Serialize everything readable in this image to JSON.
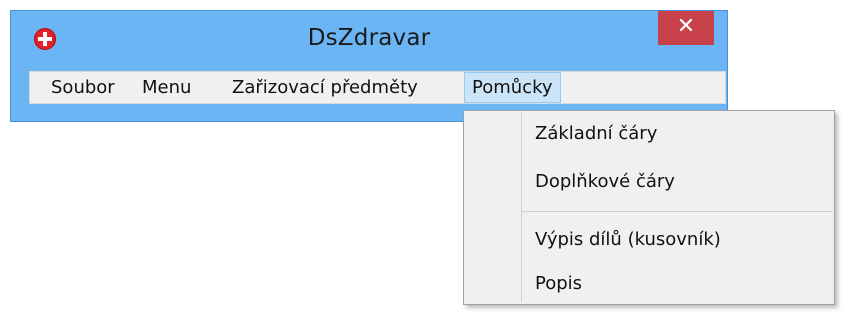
{
  "window": {
    "title": "DsZdravar",
    "close_label": "✕",
    "icon": "red-cross-app-icon"
  },
  "menubar": {
    "items": [
      {
        "label": "Soubor"
      },
      {
        "label": "Menu"
      },
      {
        "label": "Zařizovací předměty"
      },
      {
        "label": "Pomůcky",
        "active": true
      }
    ]
  },
  "dropdown": {
    "items": [
      {
        "label": "Základní čáry"
      },
      {
        "label": "Doplňkové čáry"
      },
      {
        "label": "Výpis dílů (kusovník)"
      },
      {
        "label": "Popis"
      }
    ]
  },
  "colors": {
    "titlebar": "#6cb5f5",
    "close_button": "#c9414a",
    "menu_bg": "#f0f0f0",
    "active_menu": "#cce4f7"
  }
}
